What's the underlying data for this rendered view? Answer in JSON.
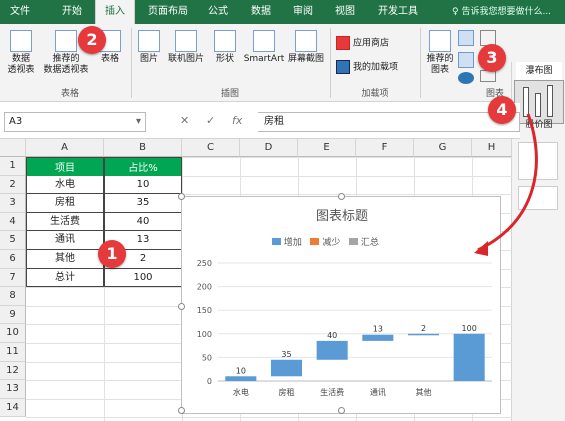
{
  "tabs": [
    "文件",
    "开始",
    "插入",
    "页面布局",
    "公式",
    "数据",
    "审阅",
    "视图",
    "开发工具"
  ],
  "tell_me": "告诉我您想要做什么...",
  "ribbon": {
    "pivot": "数据\n透视表",
    "rec_pivot": "推荐的\n数据透视表",
    "table": "表格",
    "group_tables": "表格",
    "pictures": "图片",
    "online_pictures": "联机图片",
    "shapes": "形状",
    "smartart": "SmartArt",
    "screenshot": "屏幕截图",
    "group_illustrations": "插图",
    "app_store": "应用商店",
    "my_addins": "我的加载项",
    "group_addins": "加载项",
    "rec_charts": "推荐的\n图表",
    "group_charts": "图表",
    "waterfall": "瀑布图",
    "stock": "股价图"
  },
  "formula_bar": {
    "name_box": "A3",
    "fx": "fx",
    "value": "房租"
  },
  "columns": [
    "A",
    "B",
    "C",
    "D",
    "E",
    "F",
    "G",
    "H"
  ],
  "rows": [
    "1",
    "2",
    "3",
    "4",
    "5",
    "6",
    "7",
    "8",
    "9",
    "10",
    "11",
    "12",
    "13",
    "14"
  ],
  "table": {
    "headers": [
      "项目",
      "占比%"
    ],
    "rows": [
      [
        "水电",
        "10"
      ],
      [
        "房租",
        "35"
      ],
      [
        "生活费",
        "40"
      ],
      [
        "通讯",
        "13"
      ],
      [
        "其他",
        "2"
      ],
      [
        "总计",
        "100"
      ]
    ]
  },
  "badges": [
    "1",
    "2",
    "3",
    "4"
  ],
  "colors": {
    "excel_green": "#217346",
    "header_green": "#00a651",
    "bar_blue": "#5b9bd5",
    "arrow_red": "#d9262b"
  },
  "chart_data": {
    "type": "bar",
    "title": "图表标题",
    "legend": [
      "增加",
      "减少",
      "汇总"
    ],
    "legend_colors": [
      "#5b9bd5",
      "#ed7d31",
      "#a5a5a5"
    ],
    "categories": [
      "水电",
      "房租",
      "生活费",
      "通讯",
      "其他",
      ""
    ],
    "values": [
      10,
      35,
      40,
      13,
      2,
      100
    ],
    "ylim": [
      0,
      250
    ],
    "yticks": [
      "0",
      "50",
      "100",
      "150",
      "200",
      "250"
    ]
  }
}
